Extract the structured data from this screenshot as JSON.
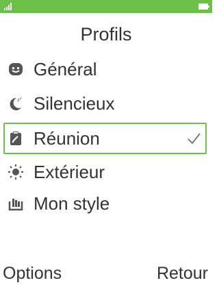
{
  "status_bar": {
    "accent_color": "#6bc048",
    "signal_icon": "signal-bars-icon",
    "battery_icon": "battery-icon"
  },
  "screen": {
    "title": "Profils"
  },
  "profiles": [
    {
      "label": "Général",
      "icon": "smiley-icon",
      "selected": false
    },
    {
      "label": "Silencieux",
      "icon": "moon-sleep-icon",
      "selected": false
    },
    {
      "label": "Réunion",
      "icon": "clipboard-icon",
      "selected": true,
      "checked": true
    },
    {
      "label": "Extérieur",
      "icon": "sun-icon",
      "selected": false
    },
    {
      "label": "Mon style",
      "icon": "custom-style-icon",
      "selected": false
    }
  ],
  "softkeys": {
    "left": "Options",
    "right": "Retour"
  },
  "colors": {
    "accent": "#6bc048",
    "text": "#333333",
    "icon": "#555555"
  }
}
